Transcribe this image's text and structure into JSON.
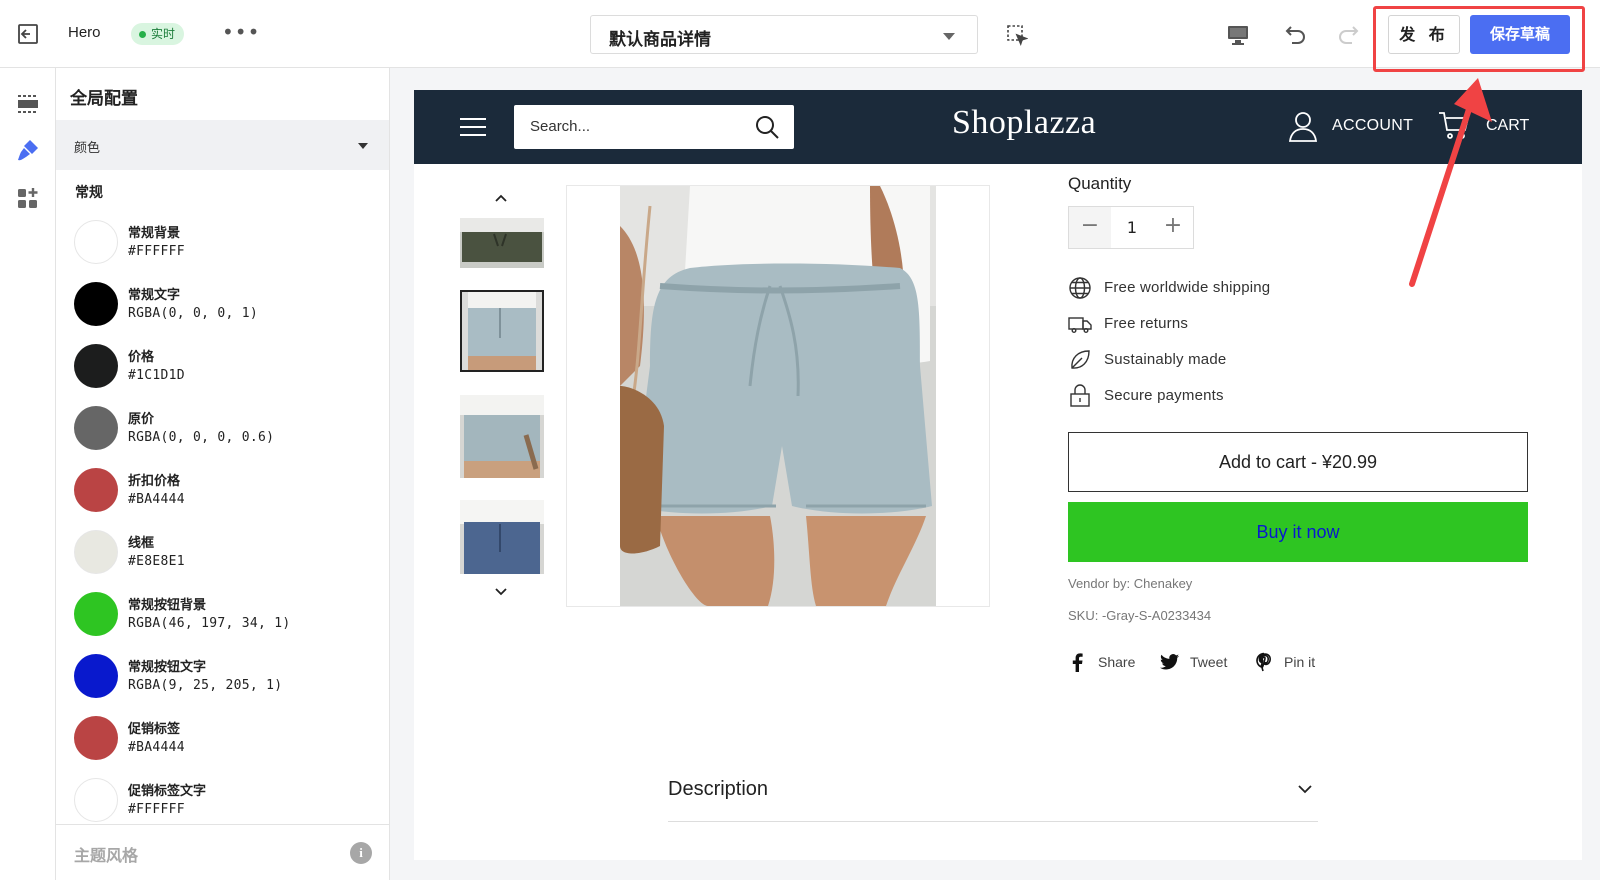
{
  "topbar": {
    "theme_name": "Hero",
    "live_badge": "实时",
    "more": "•••",
    "page_select": "默认商品详情",
    "publish_label": "发 布",
    "save_draft_label": "保存草稿"
  },
  "colors": {
    "accent": "#4b6ef2",
    "highlight": "#f04344"
  },
  "panel": {
    "title": "全局配置",
    "section": "颜色",
    "group": "常规",
    "items": [
      {
        "name": "常规背景",
        "value": "#FFFFFF",
        "swatch": "#FFFFFF"
      },
      {
        "name": "常规文字",
        "value": "RGBA(0, 0, 0, 1)",
        "swatch": "#000000"
      },
      {
        "name": "价格",
        "value": "#1C1D1D",
        "swatch": "#1C1D1D"
      },
      {
        "name": "原价",
        "value": "RGBA(0, 0, 0, 0.6)",
        "swatch": "#666666"
      },
      {
        "name": "折扣价格",
        "value": "#BA4444",
        "swatch": "#BA4444"
      },
      {
        "name": "线框",
        "value": "#E8E8E1",
        "swatch": "#E8E8E1"
      },
      {
        "name": "常规按钮背景",
        "value": "RGBA(46, 197, 34, 1)",
        "swatch": "#2EC522"
      },
      {
        "name": "常规按钮文字",
        "value": "RGBA(9, 25, 205, 1)",
        "swatch": "#0919CD"
      },
      {
        "name": "促销标签",
        "value": "#BA4444",
        "swatch": "#BA4444"
      },
      {
        "name": "促销标签文字",
        "value": "#FFFFFF",
        "swatch": "#FFFFFF"
      }
    ],
    "footer_label": "主题风格",
    "footer_info": "i"
  },
  "store": {
    "search_placeholder": "Search...",
    "logo": "Shoplazza",
    "account": "ACCOUNT",
    "cart": "CART",
    "quantity_label": "Quantity",
    "quantity_value": "1",
    "qty_minus": "−",
    "qty_plus": "+",
    "features": [
      {
        "icon": "globe-icon",
        "text": "Free worldwide shipping"
      },
      {
        "icon": "truck-icon",
        "text": "Free returns"
      },
      {
        "icon": "leaf-icon",
        "text": "Sustainably made"
      },
      {
        "icon": "lock-icon",
        "text": "Secure payments"
      }
    ],
    "add_to_cart": "Add to cart - ¥20.99",
    "buy_now": "Buy it now",
    "vendor": "Vendor by: Chenakey",
    "sku": "SKU: -Gray-S-A0233434",
    "share": "Share",
    "tweet": "Tweet",
    "pin": "Pin it",
    "description": "Description"
  }
}
